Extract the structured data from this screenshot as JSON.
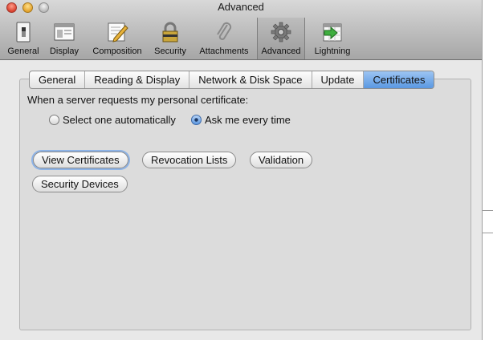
{
  "window": {
    "title": "Advanced"
  },
  "toolbar": {
    "items": [
      {
        "label": "General",
        "icon": "general-switch-icon"
      },
      {
        "label": "Display",
        "icon": "display-window-icon"
      },
      {
        "label": "Composition",
        "icon": "pencil-icon"
      },
      {
        "label": "Security",
        "icon": "padlock-icon"
      },
      {
        "label": "Attachments",
        "icon": "paperclip-icon"
      },
      {
        "label": "Advanced",
        "icon": "gear-icon"
      },
      {
        "label": "Lightning",
        "icon": "calendar-icon"
      }
    ],
    "selected": "Advanced"
  },
  "tabs": [
    {
      "label": "General"
    },
    {
      "label": "Reading & Display"
    },
    {
      "label": "Network & Disk Space"
    },
    {
      "label": "Update"
    },
    {
      "label": "Certificates"
    }
  ],
  "active_tab": "Certificates",
  "certificates": {
    "prompt": "When a server requests my personal certificate:",
    "option_auto": "Select one automatically",
    "option_ask": "Ask me every time",
    "selected_option": "Ask me every time",
    "buttons": {
      "view": "View Certificates",
      "revocation": "Revocation Lists",
      "validation": "Validation",
      "devices": "Security Devices"
    }
  },
  "colors": {
    "selection_blue": "#5a98e2",
    "focus_ring": "#8db3e6"
  }
}
